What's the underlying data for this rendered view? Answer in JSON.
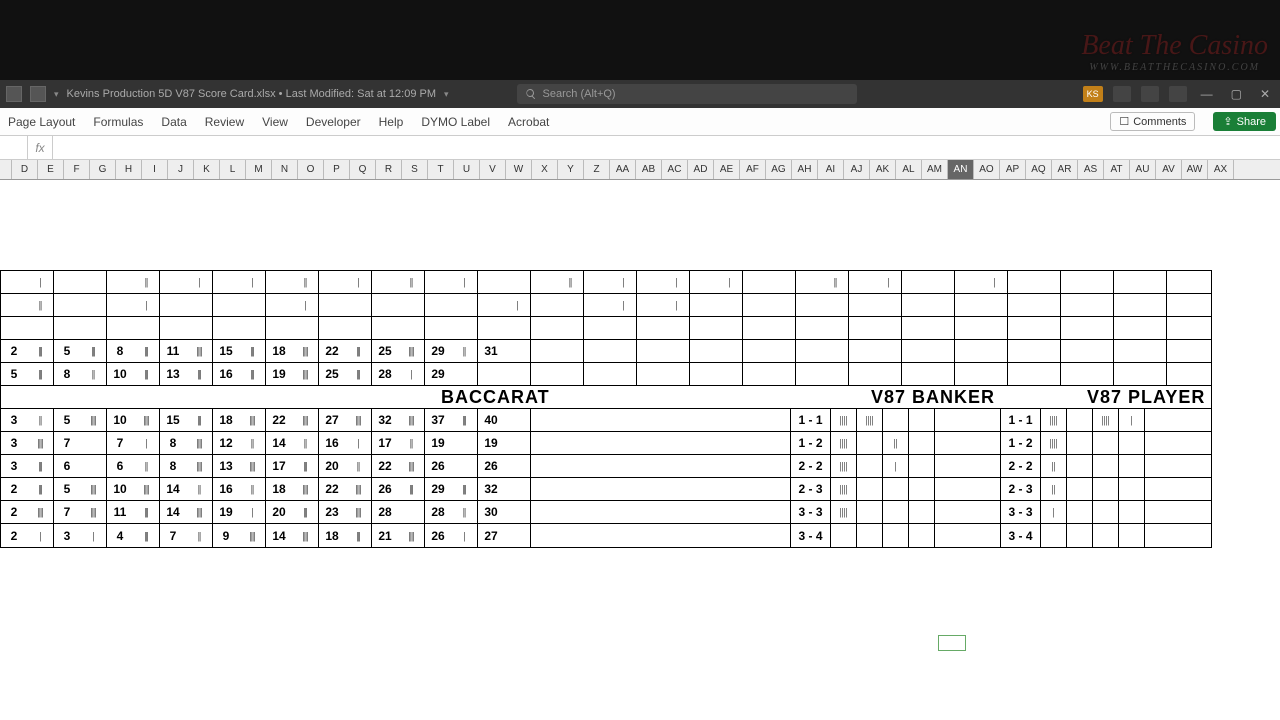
{
  "window": {
    "doc_title": "Kevins Production 5D V87 Score Card.xlsx • Last Modified: Sat at 12:09 PM",
    "search_placeholder": "Search (Alt+Q)",
    "ks_badge": "KS"
  },
  "ribbon": {
    "tabs": [
      "Page Layout",
      "Formulas",
      "Data",
      "Review",
      "View",
      "Developer",
      "Help",
      "DYMO Label",
      "Acrobat"
    ],
    "comments": "Comments",
    "share": "Share"
  },
  "fx": {
    "label": "fx"
  },
  "columns": [
    "D",
    "E",
    "F",
    "G",
    "H",
    "I",
    "J",
    "K",
    "L",
    "M",
    "N",
    "O",
    "P",
    "Q",
    "R",
    "S",
    "T",
    "U",
    "V",
    "W",
    "X",
    "Y",
    "Z",
    "AA",
    "AB",
    "AC",
    "AD",
    "AE",
    "AF",
    "AG",
    "AH",
    "AI",
    "AJ",
    "AK",
    "AL",
    "AM",
    "AN",
    "AO",
    "AP",
    "AQ",
    "AR",
    "AS",
    "AT",
    "AU",
    "AV",
    "AW",
    "AX"
  ],
  "selected_col": "AN",
  "titles": {
    "main": "BACCARAT",
    "banker": "V87 BANKER",
    "player": "V87 PLAYER"
  },
  "top_rows": [
    {
      "nums": [
        "2",
        "5",
        "8",
        "11",
        "15",
        "18",
        "22",
        "25",
        "29",
        "31"
      ],
      "tallies": [
        "|||",
        "|||",
        "|||",
        "||||",
        "|||",
        "||||",
        "|||",
        "||||",
        "||",
        ""
      ]
    },
    {
      "nums": [
        "5",
        "8",
        "10",
        "13",
        "16",
        "19",
        "25",
        "28",
        "29",
        ""
      ],
      "tallies": [
        "|||",
        "||",
        "|||",
        "|||",
        "|||",
        "||||",
        "|||",
        "|",
        "",
        ""
      ]
    }
  ],
  "main_rows": [
    {
      "nums": [
        "3",
        "5",
        "10",
        "15",
        "18",
        "22",
        "27",
        "32",
        "37",
        "40"
      ],
      "tallies": [
        "||",
        "||||",
        "||||",
        "|||",
        "||||",
        "||||",
        "||||",
        "||||",
        "|||",
        ""
      ]
    },
    {
      "nums": [
        "3",
        "7",
        "7",
        "8",
        "12",
        "14",
        "16",
        "17",
        "19",
        "19"
      ],
      "tallies": [
        "||||",
        "",
        "|",
        "||||",
        "||",
        "||",
        "|",
        "||",
        "",
        ""
      ]
    },
    {
      "nums": [
        "3",
        "6",
        "6",
        "8",
        "13",
        "17",
        "20",
        "22",
        "26",
        "26"
      ],
      "tallies": [
        "|||",
        "",
        "||",
        "||||",
        "||||",
        "|||",
        "||",
        "||||",
        "",
        ""
      ]
    },
    {
      "nums": [
        "2",
        "5",
        "10",
        "14",
        "16",
        "18",
        "22",
        "26",
        "29",
        "32"
      ],
      "tallies": [
        "|||",
        "||||",
        "||||",
        "||",
        "||",
        "||||",
        "||||",
        "|||",
        "|||",
        ""
      ]
    },
    {
      "nums": [
        "2",
        "7",
        "11",
        "14",
        "19",
        "20",
        "23",
        "28",
        "28",
        "30"
      ],
      "tallies": [
        "||||",
        "||||",
        "|||",
        "||||",
        "|",
        "|||",
        "||||",
        "",
        "||",
        ""
      ]
    },
    {
      "nums": [
        "2",
        "3",
        "4",
        "7",
        "9",
        "14",
        "18",
        "21",
        "26",
        "27"
      ],
      "tallies": [
        "|",
        "|",
        "|||",
        "||",
        "||||",
        "||||",
        "|||",
        "||||",
        "|",
        ""
      ]
    }
  ],
  "v87_banker": [
    {
      "label": "1 - 1",
      "t": [
        "||||",
        "||||",
        "",
        ""
      ]
    },
    {
      "label": "1 - 2",
      "t": [
        "||||",
        "",
        "||",
        ""
      ]
    },
    {
      "label": "2 - 2",
      "t": [
        "||||",
        "",
        "|",
        ""
      ]
    },
    {
      "label": "2 - 3",
      "t": [
        "||||",
        "",
        "",
        ""
      ]
    },
    {
      "label": "3 - 3",
      "t": [
        "||||",
        "",
        "",
        ""
      ]
    },
    {
      "label": "3 - 4",
      "t": [
        "",
        "",
        "",
        ""
      ]
    }
  ],
  "v87_player": [
    {
      "label": "1 - 1",
      "t": [
        "||||",
        "",
        "||||",
        "|"
      ]
    },
    {
      "label": "1 - 2",
      "t": [
        "||||",
        "",
        "",
        ""
      ]
    },
    {
      "label": "2 - 2",
      "t": [
        "||",
        "",
        "",
        ""
      ]
    },
    {
      "label": "2 - 3",
      "t": [
        "||",
        "",
        "",
        ""
      ]
    },
    {
      "label": "3 - 3",
      "t": [
        "|",
        "",
        "",
        ""
      ]
    },
    {
      "label": "3 - 4",
      "t": [
        "",
        "",
        "",
        ""
      ]
    }
  ],
  "watermark": {
    "main": "Beat The Casino",
    "sub": "WWW.BEATTHECASINO.COM"
  }
}
